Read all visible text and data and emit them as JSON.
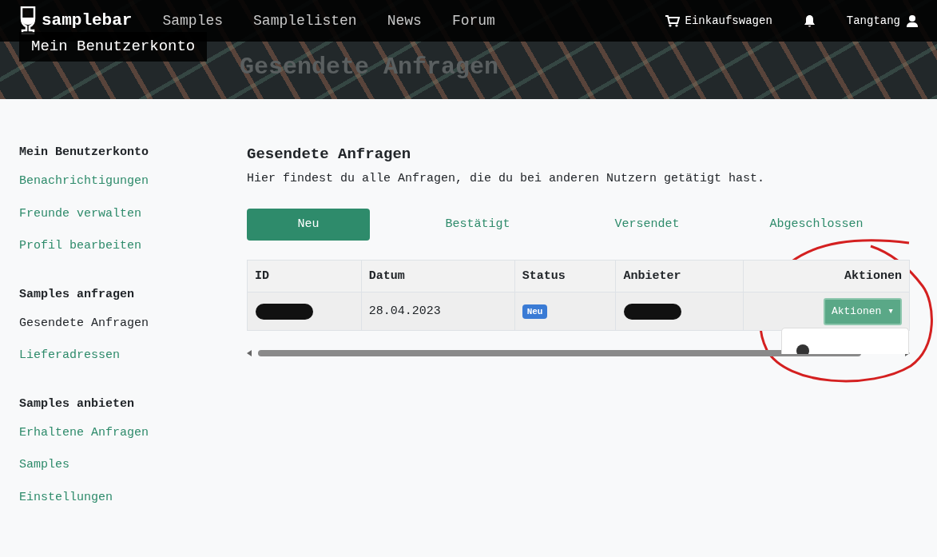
{
  "navbar": {
    "brand": "samplebar",
    "links": [
      {
        "label": "Samples"
      },
      {
        "label": "Samplelisten"
      },
      {
        "label": "News"
      },
      {
        "label": "Forum"
      }
    ],
    "cart": "Einkaufswagen",
    "user": "Tangtang"
  },
  "hero": {
    "background_title": "Gesendete Anfragen",
    "title": "Mein Benutzerkonto"
  },
  "sidebar": {
    "sections": [
      {
        "heading": "Mein Benutzerkonto",
        "items": [
          {
            "label": "Benachrichtigungen",
            "selected": false
          },
          {
            "label": "Freunde verwalten",
            "selected": false
          },
          {
            "label": "Profil bearbeiten",
            "selected": false
          }
        ]
      },
      {
        "heading": "Samples anfragen",
        "items": [
          {
            "label": "Gesendete Anfragen",
            "selected": true
          },
          {
            "label": "Lieferadressen",
            "selected": false
          }
        ]
      },
      {
        "heading": "Samples anbieten",
        "items": [
          {
            "label": "Erhaltene Anfragen",
            "selected": false
          },
          {
            "label": "Samples",
            "selected": false
          },
          {
            "label": "Einstellungen",
            "selected": false
          }
        ]
      }
    ]
  },
  "main": {
    "title": "Gesendete Anfragen",
    "description": "Hier findest du alle Anfragen, die du bei anderen Nutzern getätigt hast.",
    "tabs": [
      {
        "label": "Neu",
        "selected": true
      },
      {
        "label": "Bestätigt",
        "selected": false
      },
      {
        "label": "Versendet",
        "selected": false
      },
      {
        "label": "Abgeschlossen",
        "selected": false
      }
    ],
    "table": {
      "columns": [
        "ID",
        "Datum",
        "Status",
        "Anbieter",
        "Aktionen"
      ],
      "rows": [
        {
          "id_redacted": true,
          "date": "28.04.2023",
          "status": "Neu",
          "provider_redacted": true,
          "action": "Aktionen",
          "caret": "▾",
          "menu_open": true
        }
      ]
    }
  }
}
